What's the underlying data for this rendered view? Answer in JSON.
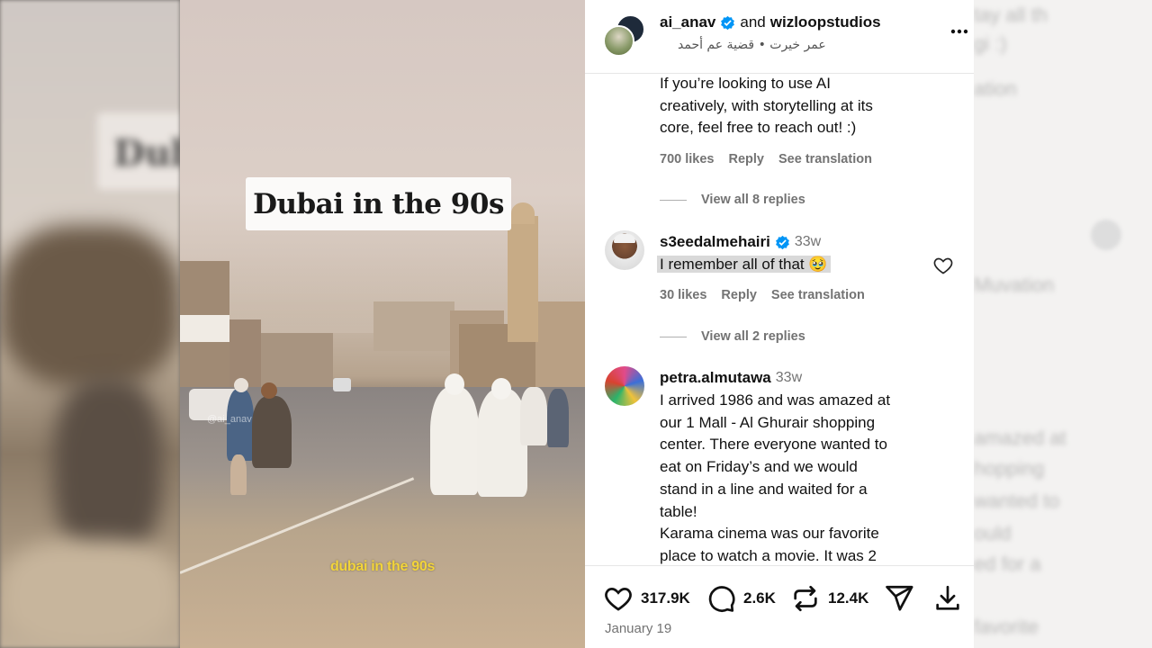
{
  "video": {
    "title_card": "Dubai in the 90s",
    "caption": "dubai in the 90s",
    "watermark": "@ai_anav"
  },
  "post": {
    "author": "ai_anav",
    "and_label": "and",
    "collaborator": "wizloopstudios",
    "audio_line": "عمر خيرت • قضية عم أحمد",
    "more_icon": "more-options-icon"
  },
  "comments": [
    {
      "text_lines": [
        "If you’re looking to use AI",
        "creatively, with storytelling at its",
        "core, feel free to reach out! :)"
      ],
      "likes": "700 likes",
      "reply": "Reply",
      "see_translation": "See translation",
      "view_replies": "View all 8 replies"
    },
    {
      "username": "s3eedalmehairi",
      "time": "33w",
      "text": "I remember all of that 🥹",
      "likes": "30 likes",
      "reply": "Reply",
      "see_translation": "See translation",
      "view_replies": "View all 2 replies"
    },
    {
      "username": "petra.almutawa",
      "time": "33w",
      "text_lines": [
        "I arrived 1986 and was amazed at",
        "our 1 Mall - Al Ghurair shopping",
        "center. There everyone wanted to",
        "eat on Friday’s and we would",
        "stand in a line and waited for a",
        "table!",
        "Karama cinema was our favorite",
        "place to watch a movie. It was 2"
      ]
    }
  ],
  "actions": {
    "likes": "317.9K",
    "comments": "2.6K",
    "reposts": "12.4K",
    "date": "January 19"
  },
  "background_right_ghost": [
    "tay all th",
    "gi :)",
    "ation",
    "Muvation",
    "amazed at",
    "hopping",
    "wanted to",
    "ould",
    "ed for a",
    "favorite"
  ],
  "background_left_ghost": "Dub"
}
